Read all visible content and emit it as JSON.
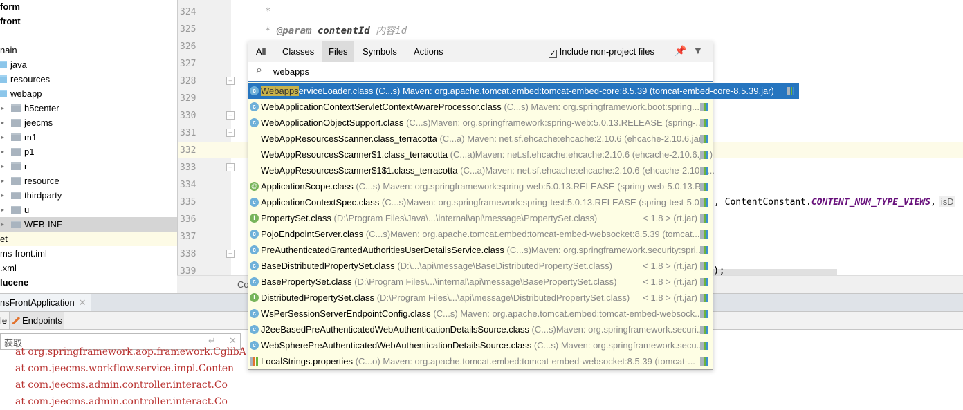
{
  "project_tree": [
    {
      "label": "form",
      "bold": true
    },
    {
      "label": "front",
      "bold": true
    },
    {
      "label": ""
    },
    {
      "label": "nain"
    },
    {
      "label": "java",
      "icon": "blue-folder"
    },
    {
      "label": "resources",
      "icon": "resources-folder"
    },
    {
      "label": "webapp",
      "icon": "web-folder"
    },
    {
      "label": "h5center",
      "icon": "folder"
    },
    {
      "label": "jeecms",
      "icon": "folder"
    },
    {
      "label": "m1",
      "icon": "folder"
    },
    {
      "label": "p1",
      "icon": "folder"
    },
    {
      "label": "r",
      "icon": "folder"
    },
    {
      "label": "resource",
      "icon": "folder"
    },
    {
      "label": "thirdparty",
      "icon": "folder"
    },
    {
      "label": "u",
      "icon": "folder"
    },
    {
      "label": "WEB-INF",
      "icon": "folder",
      "selected": true
    },
    {
      "label": "et"
    },
    {
      "label": "ms-front.iml"
    },
    {
      "label": ".xml"
    },
    {
      "label": "lucene",
      "bold": true
    }
  ],
  "line_numbers": [
    "324",
    "325",
    "326",
    "327",
    "328",
    "329",
    "330",
    "331",
    "332",
    "333",
    "334",
    "335",
    "336",
    "337",
    "338",
    "339"
  ],
  "code": {
    "l324": "*",
    "l325_star": "* ",
    "l325_tag": "@param",
    "l325_name": " contentId ",
    "l325_desc": "内容id",
    "l335_a": ", ContentConstant.",
    "l335_b": "CONTENT_NUM_TYPE_VIEWS",
    "l335_c": ",",
    "l335_hint": "isD",
    "l339": ");",
    "bottom_fragment": "Co"
  },
  "run_panel": {
    "tab": "nsFrontApplication",
    "subtab_partial": "le",
    "subtab_endpoints": "Endpoints",
    "find_value": "获取",
    "console": [
      "at org.springframework.aop.framework.CglibA",
      "at com.jeecms.workflow.service.impl.Conten",
      "at com.jeecms.admin.controller.interact.Co",
      "at com.jeecms.admin.controller.interact.Co"
    ]
  },
  "popup": {
    "tabs": [
      "All",
      "Classes",
      "Files",
      "Symbols",
      "Actions"
    ],
    "active_tab": "Files",
    "include_label": "Include non-project files",
    "include_checked": true,
    "query": "webapps",
    "results": [
      {
        "icon": "c",
        "hl": "Webapps",
        "name": "erviceLoader.class",
        "loc": "(C...s)   Maven: org.apache.tomcat.embed:tomcat-embed-core:8.5.39 (tomcat-embed-core-8.5.39.jar)",
        "selected": true
      },
      {
        "icon": "c",
        "name": "WebApplicationContextServletContextAwareProcessor.class",
        "loc": "(C...s) Maven: org.springframework.boot:spring..."
      },
      {
        "icon": "c",
        "name": "WebApplicationObjectSupport.class",
        "loc": "(C...s)Maven: org.springframework:spring-web:5.0.13.RELEASE (spring-..."
      },
      {
        "icon": "",
        "name": "WebAppResourcesScanner.class_terracotta",
        "loc": "(C...a)    Maven: net.sf.ehcache:ehcache:2.10.6 (ehcache-2.10.6.jar)"
      },
      {
        "icon": "",
        "name": "WebAppResourcesScanner$1.class_terracotta",
        "loc": "(C...a)Maven: net.sf.ehcache:ehcache:2.10.6 (ehcache-2.10.6.jar)"
      },
      {
        "icon": "",
        "name": "WebAppResourcesScanner$1$1.class_terracotta",
        "loc": "(C...a)Maven: net.sf.ehcache:ehcache:2.10.6 (ehcache-2.10.6..."
      },
      {
        "icon": "a",
        "name": "ApplicationScope.class",
        "loc": "(C...s) Maven: org.springframework:spring-web:5.0.13.RELEASE (spring-web-5.0.13.R..."
      },
      {
        "icon": "c",
        "name": "ApplicationContextSpec.class",
        "loc": "(C...s)Maven: org.springframework:spring-test:5.0.13.RELEASE (spring-test-5.0..."
      },
      {
        "icon": "i",
        "name": "PropertySet.class",
        "loc": "(D:\\Program Files\\Java\\...\\internal\\api\\message\\PropertySet.class)",
        "right": "< 1.8 > (rt.jar)"
      },
      {
        "icon": "c",
        "name": "PojoEndpointServer.class",
        "loc": "(C...s)Maven: org.apache.tomcat.embed:tomcat-embed-websocket:8.5.39 (tomcat..."
      },
      {
        "icon": "c",
        "name": "PreAuthenticatedGrantedAuthoritiesUserDetailsService.class",
        "loc": "(C...s)Maven: org.springframework.security:spri..."
      },
      {
        "icon": "c",
        "name": "BaseDistributedPropertySet.class",
        "loc": "(D:\\...\\api\\message\\BaseDistributedPropertySet.class)",
        "right": "< 1.8 > (rt.jar)"
      },
      {
        "icon": "c",
        "name": "BasePropertySet.class",
        "loc": "(D:\\Program Files\\...\\internal\\api\\message\\BasePropertySet.class)",
        "right": "< 1.8 > (rt.jar)"
      },
      {
        "icon": "i",
        "name": "DistributedPropertySet.class",
        "loc": "(D:\\Program Files\\...\\api\\message\\DistributedPropertySet.class)",
        "right": "< 1.8 > (rt.jar)"
      },
      {
        "icon": "c",
        "name": "WsPerSessionServerEndpointConfig.class",
        "loc": "(C...s) Maven: org.apache.tomcat.embed:tomcat-embed-websock..."
      },
      {
        "icon": "c",
        "name": "J2eeBasedPreAuthenticatedWebAuthenticationDetailsSource.class",
        "loc": "(C...s)Maven: org.springframework.securi..."
      },
      {
        "icon": "c",
        "name": "WebSpherePreAuthenticatedWebAuthenticationDetailsSource.class",
        "loc": "(C...s) Maven: org.springframework.secu..."
      },
      {
        "icon": "p",
        "name": "LocalStrings.properties",
        "loc": "(C...o)  Maven: org.apache.tomcat.embed:tomcat-embed-websocket:8.5.39 (tomcat-..."
      }
    ]
  }
}
